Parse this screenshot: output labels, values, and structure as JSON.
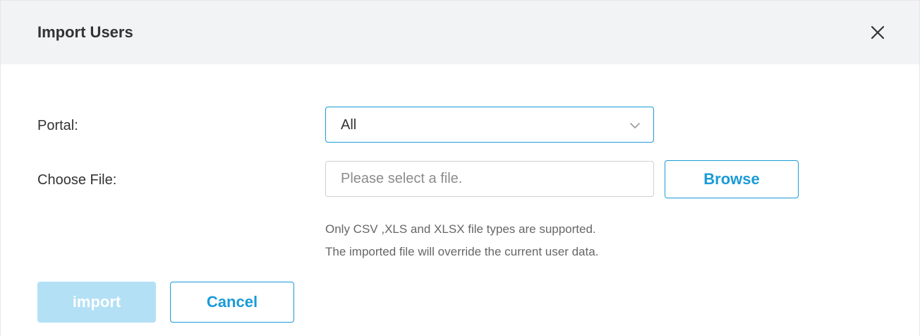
{
  "dialog": {
    "title": "Import Users",
    "close_icon": "close-icon"
  },
  "form": {
    "portal": {
      "label": "Portal:",
      "selected_value": "All",
      "dropdown_icon": "chevron-down-icon"
    },
    "choose_file": {
      "label": "Choose File:",
      "value": "",
      "placeholder": "Please select a file.",
      "browse_label": "Browse"
    },
    "hints": [
      "Only CSV ,XLS and XLSX file types are supported.",
      "The imported file will override the current user data."
    ]
  },
  "actions": {
    "import_label": "import",
    "import_disabled": true,
    "cancel_label": "Cancel"
  },
  "colors": {
    "accent": "#1a9bd7",
    "header_bg": "#f2f3f5",
    "disabled_button_bg": "#b3e0f5",
    "text": "#333333",
    "hint_text": "#666666",
    "placeholder": "#8c8c8c",
    "input_border": "#d0d0d0"
  }
}
